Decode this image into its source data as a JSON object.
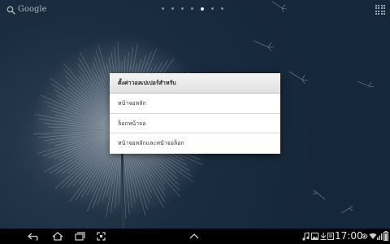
{
  "home": {
    "search_label": "Google",
    "page_dots": [
      {
        "active": false
      },
      {
        "active": false
      },
      {
        "active": false
      },
      {
        "active": false
      },
      {
        "active": true
      },
      {
        "active": false
      },
      {
        "active": false
      }
    ]
  },
  "dialog": {
    "title": "ตั้งค่าวอลเปเปอร์สำหรับ",
    "options": [
      "หน้าจอหลัก",
      "ล็อกหน้าจอ",
      "หน้าจอหลักและหน้าจอล็อก"
    ]
  },
  "system_bar": {
    "clock": "17:00",
    "nav_icons": [
      "back-icon",
      "home-icon",
      "recent-apps-icon",
      "screenshot-icon",
      "menu-up-icon"
    ],
    "status_icons": [
      "music-icon",
      "image-icon",
      "download-icon",
      "notification-icon",
      "nfc-icon",
      "wifi-icon",
      "signal-icon",
      "battery-icon"
    ],
    "colors": {
      "background": "#000000",
      "icon": "#cfcfcf"
    }
  }
}
